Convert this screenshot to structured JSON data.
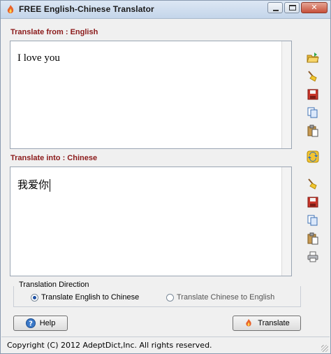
{
  "window": {
    "title": "FREE English-Chinese Translator"
  },
  "source": {
    "label": "Translate from : English",
    "text": "I love you"
  },
  "target": {
    "label": "Translate into : Chinese",
    "text": "我爱你"
  },
  "direction": {
    "legend": "Translation Direction",
    "options": [
      {
        "label": "Translate English to Chinese",
        "selected": true
      },
      {
        "label": "Translate Chinese to English",
        "selected": false
      }
    ]
  },
  "buttons": {
    "help": "Help",
    "translate": "Translate"
  },
  "status": {
    "copyright": "Copyright (C) 2012 AdeptDict,Inc. All rights reserved."
  },
  "icons": {
    "source_tools": [
      "open-folder-icon",
      "clear-broom-icon",
      "save-disk-icon",
      "copy-icon",
      "paste-icon"
    ],
    "swap": "swap-arrows-icon",
    "target_tools": [
      "clear-broom-icon",
      "save-disk-icon",
      "copy-icon",
      "paste-icon",
      "print-icon"
    ]
  },
  "colors": {
    "section_label": "#8b1a1a",
    "titlebar": "#c4d5ea"
  }
}
